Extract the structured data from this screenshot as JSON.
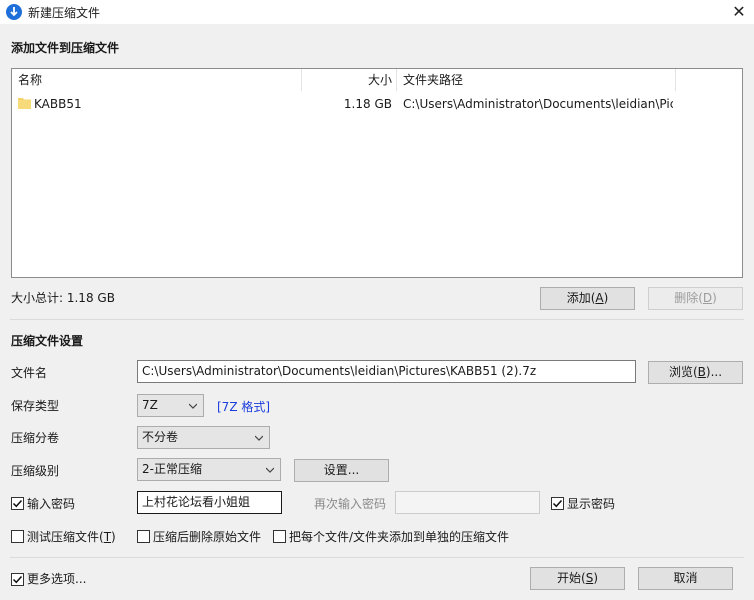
{
  "window": {
    "title": "新建压缩文件",
    "close": "✕"
  },
  "add_section": {
    "title": "添加文件到压缩文件",
    "columns": {
      "name": "名称",
      "size": "大小",
      "path": "文件夹路径"
    },
    "files": [
      {
        "name": "KABB51",
        "size": "1.18 GB",
        "path": "C:\\Users\\Administrator\\Documents\\leidian\\Pic..."
      }
    ],
    "total_label": "大小总计: 1.18 GB",
    "add_button": {
      "label": "添加(",
      "key": "A",
      "end": ")"
    },
    "delete_button": {
      "label": "删除(",
      "key": "D",
      "end": ")"
    }
  },
  "settings": {
    "title": "压缩文件设置",
    "filename_label": "文件名",
    "filename_value": "C:\\Users\\Administrator\\Documents\\leidian\\Pictures\\KABB51 (2).7z",
    "browse_button": {
      "label": "浏览(",
      "key": "B",
      "end": ")..."
    },
    "save_type_label": "保存类型",
    "save_type_value": "7Z",
    "format_link": "[7Z 格式]",
    "split_label": "压缩分卷",
    "split_value": "不分卷",
    "level_label": "压缩级别",
    "level_value": "2-正常压缩",
    "settings_button": "设置...",
    "password_checkbox_label": "输入密码",
    "password_checked": true,
    "password_value": "上村花论坛看小姐姐",
    "reenter_label": "再次输入密码",
    "show_password_label": "显示密码",
    "show_password_checked": true,
    "test_label": {
      "label": "测试压缩文件(",
      "key": "T",
      "end": ")"
    },
    "test_checked": false,
    "delete_original_label": "压缩后删除原始文件",
    "delete_original_checked": false,
    "separate_label": "把每个文件/文件夹添加到单独的压缩文件",
    "separate_checked": false
  },
  "footer": {
    "more_options_label": "更多选项...",
    "more_options_checked": true,
    "start_button": {
      "label": "开始(",
      "key": "S",
      "end": ")"
    },
    "cancel_button": "取消"
  },
  "colors": {
    "accent": "#1e6fd9",
    "link": "#1a3edc",
    "folder": "#f5d26b"
  }
}
